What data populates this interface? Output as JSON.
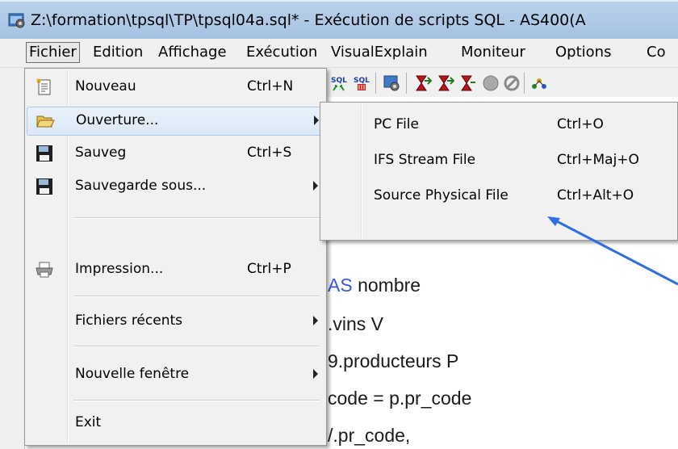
{
  "window": {
    "title": "Z:\\formation\\tpsql\\TP\\tpsql04a.sql* - Exécution de scripts SQL - AS400(A",
    "icon": "sql-script-app-icon"
  },
  "menubar": {
    "items": [
      "Fichier",
      "Edition",
      "Affichage",
      "Exécution",
      "VisualExplain",
      "Moniteur",
      "Options",
      "Co"
    ],
    "active": "Fichier"
  },
  "toolbar": {
    "icons": [
      "sql-run-icon",
      "sql-stop-icon",
      "database-settings-icon",
      "hourglass-run-icon",
      "hourglass-next-icon",
      "hourglass-step-icon",
      "stop-circle-icon",
      "cancel-icon",
      "visual-explain-icon"
    ]
  },
  "file_menu": {
    "items": [
      {
        "label": "Nouveau",
        "shortcut": "Ctrl+N",
        "icon": "new-document-icon",
        "submenu": false
      },
      {
        "label": "Ouverture...",
        "shortcut": "",
        "icon": "open-folder-icon",
        "submenu": true,
        "highlighted": true
      },
      {
        "label": "Sauveg",
        "shortcut": "Ctrl+S",
        "icon": "floppy-disk-icon",
        "submenu": false
      },
      {
        "label": "Sauvegarde sous...",
        "shortcut": "",
        "icon": "floppy-disk-icon",
        "submenu": true
      },
      {
        "label": "Impression...",
        "shortcut": "Ctrl+P",
        "icon": "printer-icon",
        "submenu": false
      },
      {
        "label": "Fichiers récents",
        "shortcut": "",
        "icon": "",
        "submenu": true
      },
      {
        "label": "Nouvelle fenêtre",
        "shortcut": "",
        "icon": "",
        "submenu": true
      },
      {
        "label": "Exit",
        "shortcut": "",
        "icon": "",
        "submenu": false
      }
    ]
  },
  "open_submenu": {
    "items": [
      {
        "label": "PC File",
        "shortcut": "Ctrl+O"
      },
      {
        "label": "IFS Stream File",
        "shortcut": "Ctrl+Maj+O"
      },
      {
        "label": "Source Physical File",
        "shortcut": "Ctrl+Alt+O"
      }
    ]
  },
  "editor": {
    "lines": [
      {
        "keyword": "AS",
        "text": " nombre"
      },
      {
        "keyword": "",
        "text": ".vins V"
      },
      {
        "keyword": "",
        "text": "9.producteurs P"
      },
      {
        "keyword": "",
        "text": "code = p.pr_code"
      },
      {
        "keyword": "",
        "text": "/.pr_code,"
      }
    ]
  },
  "colors": {
    "titlebar": "#b9d1ea",
    "menu_bg": "#f1f1f1",
    "highlight_border": "#a9c8ef",
    "keyword": "#3a55e0",
    "callout_arrow": "#2f6fe0"
  }
}
